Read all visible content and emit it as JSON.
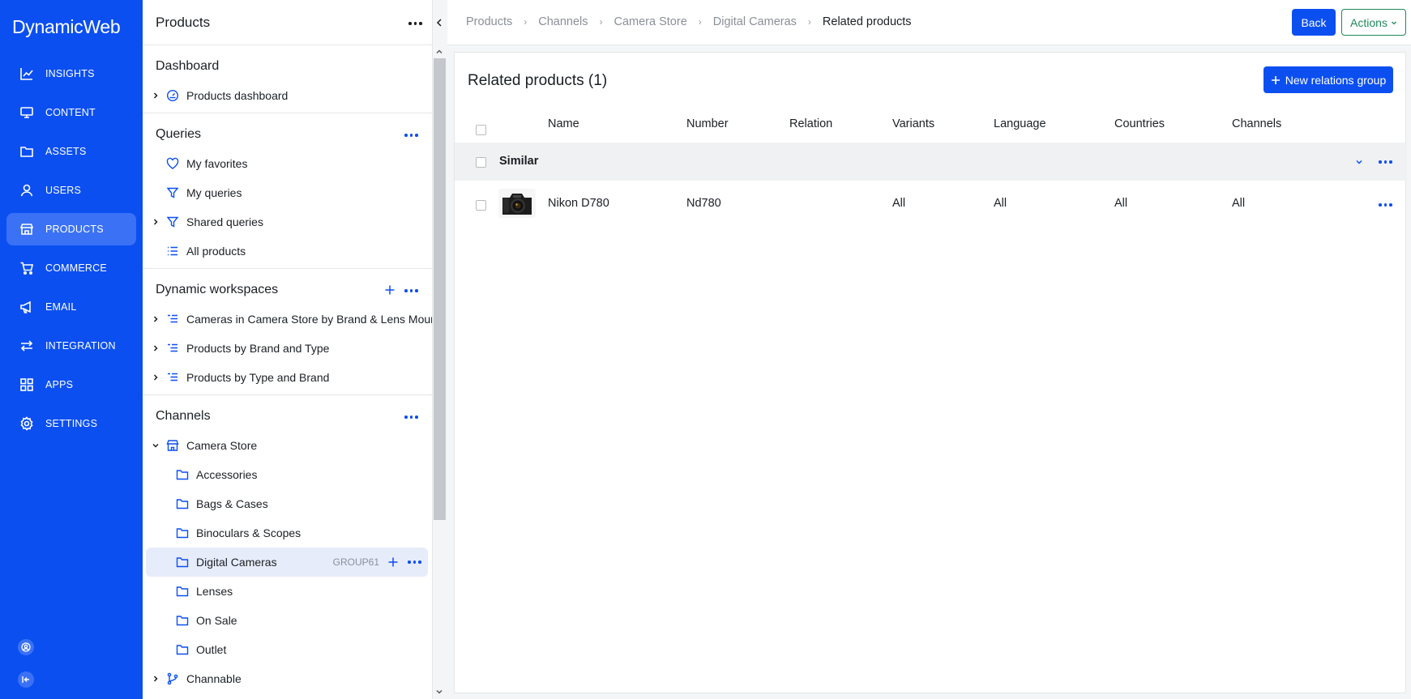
{
  "nav": {
    "logo": "DynamicWeb",
    "items": [
      {
        "label": "INSIGHTS",
        "icon": "chart-line-icon"
      },
      {
        "label": "CONTENT",
        "icon": "monitor-icon"
      },
      {
        "label": "ASSETS",
        "icon": "folder-icon"
      },
      {
        "label": "USERS",
        "icon": "user-icon"
      },
      {
        "label": "PRODUCTS",
        "icon": "store-icon",
        "active": true
      },
      {
        "label": "COMMERCE",
        "icon": "cart-icon"
      },
      {
        "label": "EMAIL",
        "icon": "megaphone-icon"
      },
      {
        "label": "INTEGRATION",
        "icon": "arrows-icon"
      },
      {
        "label": "APPS",
        "icon": "grid-icon"
      },
      {
        "label": "SETTINGS",
        "icon": "gear-icon"
      }
    ],
    "bottom_icons": [
      "user-circle-icon",
      "collapse-nav-icon"
    ],
    "colors": {
      "primary": "#0b4ff1",
      "active": "#3a71f5"
    }
  },
  "tree": {
    "title": "Products",
    "dashboard": {
      "title": "Dashboard",
      "items": [
        {
          "label": "Products dashboard"
        }
      ]
    },
    "queries": {
      "title": "Queries",
      "items": [
        {
          "label": "My favorites"
        },
        {
          "label": "My queries"
        },
        {
          "label": "Shared queries"
        },
        {
          "label": "All products"
        }
      ]
    },
    "workspaces": {
      "title": "Dynamic workspaces",
      "items": [
        {
          "label": "Cameras in Camera Store by Brand & Lens Mount"
        },
        {
          "label": "Products by Brand and Type"
        },
        {
          "label": "Products by Type and Brand"
        }
      ]
    },
    "channels": {
      "title": "Channels",
      "store": "Camera Store",
      "folders": [
        {
          "label": "Accessories"
        },
        {
          "label": "Bags & Cases"
        },
        {
          "label": "Binoculars & Scopes"
        },
        {
          "label": "Digital Cameras",
          "tag": "GROUP61",
          "selected": true
        },
        {
          "label": "Lenses"
        },
        {
          "label": "On Sale"
        },
        {
          "label": "Outlet"
        }
      ],
      "extra": "Channable"
    }
  },
  "breadcrumb": [
    "Products",
    "Channels",
    "Camera Store",
    "Digital Cameras",
    "Related products"
  ],
  "header": {
    "back_label": "Back",
    "actions_label": "Actions"
  },
  "main": {
    "title": "Related products (1)",
    "new_button": "New relations group",
    "columns": [
      "Name",
      "Number",
      "Relation",
      "Variants",
      "Language",
      "Countries",
      "Channels"
    ],
    "group": {
      "name": "Similar"
    },
    "rows": [
      {
        "name": "Nikon D780",
        "number": "Nd780",
        "relation": "",
        "variants": "All",
        "language": "All",
        "countries": "All",
        "channels": "All"
      }
    ]
  }
}
